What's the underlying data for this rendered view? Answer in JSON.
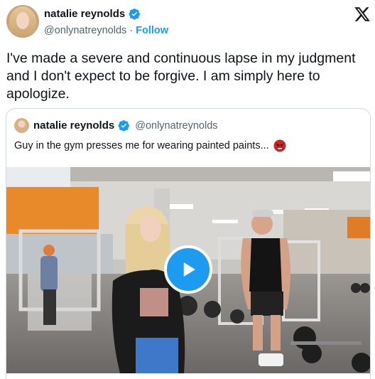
{
  "author": {
    "name": "natalie reynolds",
    "handle": "@onlynatreynolds",
    "separator": "·",
    "follow_label": "Follow"
  },
  "tweet": {
    "text": "I've made a severe and continuous lapse in my judgment and I don't expect to be forgive. I am simply here to apologize."
  },
  "quoted": {
    "name": "natalie reynolds",
    "handle": "@onlynatreynolds",
    "text": "Guy in the gym presses me for wearing painted paints...",
    "emoji": "angry-face-emoji"
  },
  "media": {
    "type": "video",
    "play_icon": "play-icon"
  },
  "colors": {
    "accent": "#1d9bf0",
    "text": "#0f1419",
    "secondary": "#536471",
    "border": "#cfd9de"
  }
}
